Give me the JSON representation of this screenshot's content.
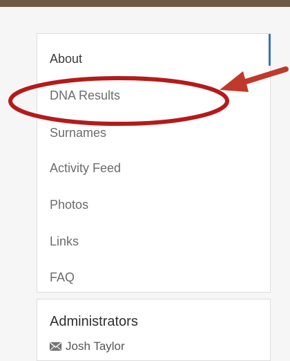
{
  "sidebar": {
    "items": [
      {
        "label": "About"
      },
      {
        "label": "DNA Results"
      },
      {
        "label": "Surnames"
      },
      {
        "label": "Activity Feed"
      },
      {
        "label": "Photos"
      },
      {
        "label": "Links"
      },
      {
        "label": "FAQ"
      }
    ],
    "active_index": 0
  },
  "administrators": {
    "title": "Administrators",
    "members": [
      {
        "name": "Josh Taylor",
        "icon": "mail-icon"
      }
    ]
  },
  "annotation": {
    "ellipse_color": "#b51a1a",
    "arrow_color": "#c0392b",
    "highlights": "DNA Results"
  },
  "colors": {
    "accent": "#3a6fc4",
    "top_bar": "#6e5a47"
  }
}
